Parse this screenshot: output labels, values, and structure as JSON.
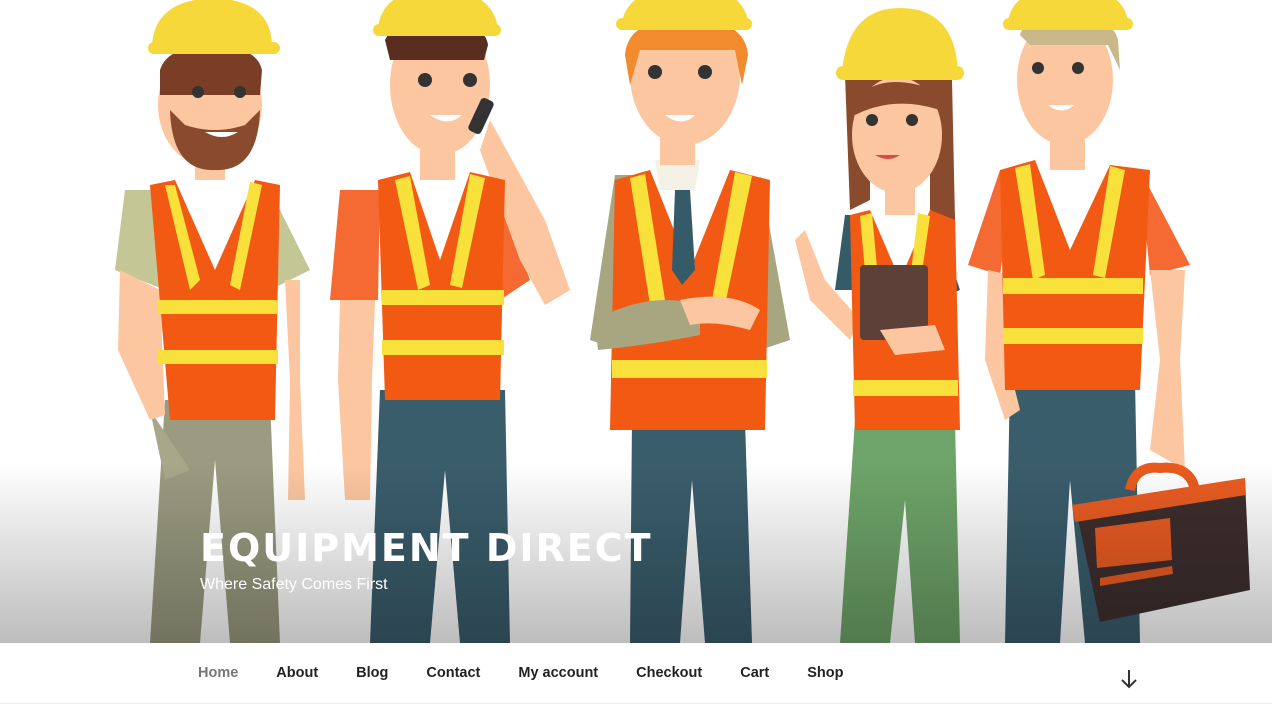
{
  "header": {
    "site_title": "Equipment Direct",
    "site_description": "Where Safety Comes First",
    "hero_image": "construction-workers-illustration"
  },
  "nav": {
    "items": [
      {
        "label": "Home",
        "current": true
      },
      {
        "label": "About"
      },
      {
        "label": "Blog"
      },
      {
        "label": "Contact"
      },
      {
        "label": "My account"
      },
      {
        "label": "Checkout"
      },
      {
        "label": "Cart"
      },
      {
        "label": "Shop"
      }
    ],
    "scroll_icon": "arrow-down-icon"
  },
  "colors": {
    "hardhat": "#f7d83b",
    "vest": "#f25a14",
    "reflective_stripe": "#f7e13a",
    "skin": "#fcc6a0",
    "pants_blue": "#3a5d6c",
    "text_dark": "#222222",
    "text_current": "#767676"
  }
}
